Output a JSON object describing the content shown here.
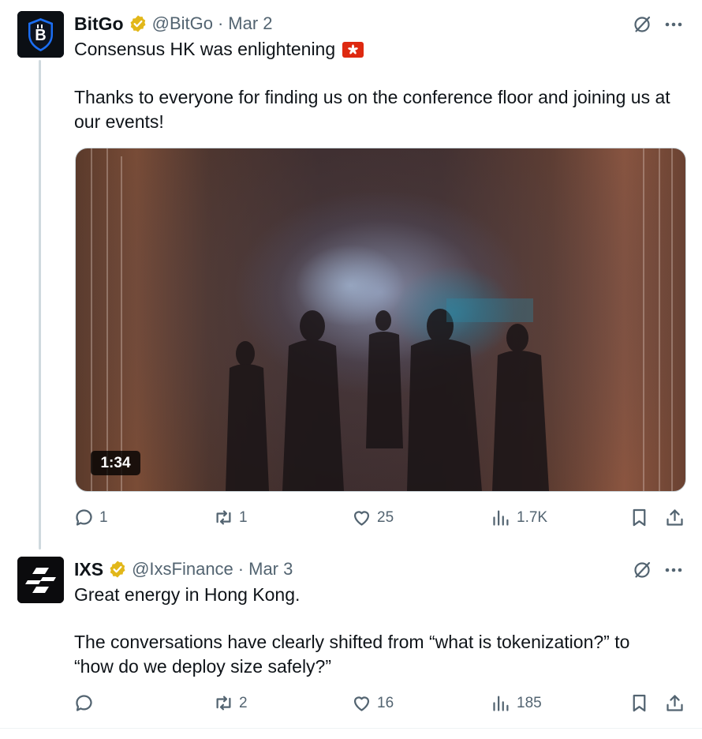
{
  "tweets": [
    {
      "display_name": "BitGo",
      "handle": "@BitGo",
      "separator": "·",
      "date": "Mar 2",
      "avatar_letter": "B",
      "line1": "Consensus HK was enlightening",
      "flag_icon": "hong-kong-flag-icon",
      "line2": "Thanks to everyone for finding us on the conference floor and joining us at our events!",
      "media": {
        "type": "video",
        "duration": "1:34"
      },
      "actions": {
        "reply": "1",
        "repost": "1",
        "like": "25",
        "views": "1.7K"
      }
    },
    {
      "display_name": "IXS",
      "handle": "@IxsFinance",
      "separator": "·",
      "date": "Mar 3",
      "line1": "Great energy in Hong Kong.",
      "line2": "The conversations have clearly shifted from “what is tokenization?” to “how do we deploy size safely?”",
      "actions": {
        "reply": "",
        "repost": "2",
        "like": "16",
        "views": "185"
      }
    }
  ],
  "icons": {
    "verified": "verified-gold-badge-icon",
    "grok": "grok-icon",
    "more": "more-dots-icon",
    "reply": "reply-icon",
    "repost": "repost-icon",
    "like": "heart-icon",
    "views": "views-icon",
    "bookmark": "bookmark-icon",
    "share": "share-icon"
  },
  "colors": {
    "text": "#0f1419",
    "secondary": "#536471",
    "verified_gold": "#e2b719",
    "thread_line": "#cfd9de",
    "hk_flag_red": "#de2910"
  }
}
